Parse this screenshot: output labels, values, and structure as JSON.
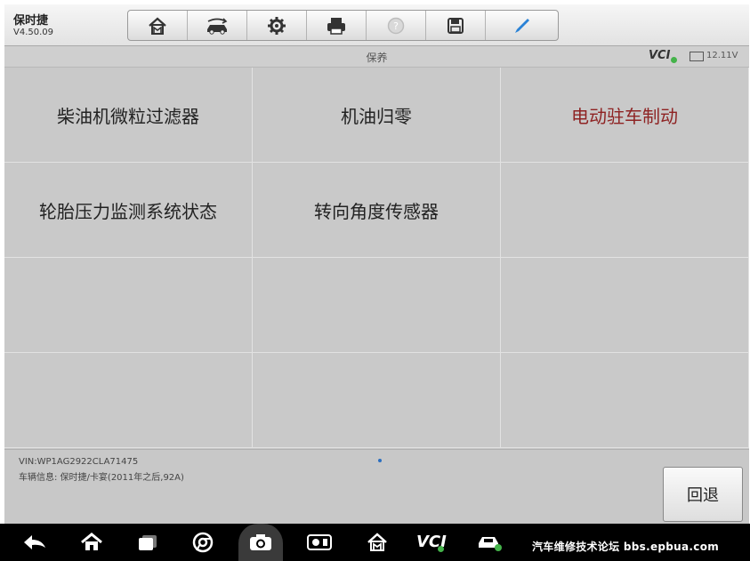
{
  "header": {
    "app_title": "保时捷",
    "version": "V4.50.09",
    "toolbar": [
      {
        "icon": "home-icon"
      },
      {
        "icon": "vehicle-swap-icon"
      },
      {
        "icon": "gear-icon"
      },
      {
        "icon": "printer-icon"
      },
      {
        "icon": "help-icon",
        "disabled": true
      },
      {
        "icon": "save-icon"
      },
      {
        "icon": "pen-icon"
      }
    ]
  },
  "subbar": {
    "title": "保养",
    "vci_label": "VCI",
    "vci_status_color": "#44b34a",
    "voltage": "12.11V"
  },
  "menu": {
    "items": [
      {
        "label": "柴油机微粒过滤器"
      },
      {
        "label": "机油归零"
      },
      {
        "label": "电动驻车制动",
        "highlight_color": "#8e2323"
      },
      {
        "label": "轮胎压力监测系统状态"
      },
      {
        "label": "转向角度传感器"
      }
    ]
  },
  "footer": {
    "vin": "VIN:WP1AG2922CLA71475",
    "vehicle_info": "车辆信息: 保时捷/卡宴(2011年之后,92A)",
    "back_button": "回退"
  },
  "navbar": {
    "vci_label": "VCI",
    "watermark": "汽车维修技术论坛 bbs.epbua.com"
  }
}
